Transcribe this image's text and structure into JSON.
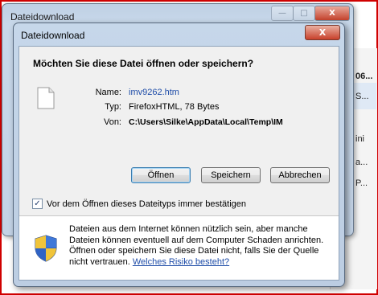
{
  "background_window": {
    "title": "Dateidownload",
    "minimize_label": "—",
    "maximize_label": "□",
    "close_label": "X",
    "rows": [
      "06...",
      "S...",
      "ini",
      "a...",
      "P..."
    ]
  },
  "dialog": {
    "title": "Dateidownload",
    "close_label": "X",
    "question": "Möchten Sie diese Datei öffnen oder speichern?",
    "fields": [
      {
        "label": "Name:",
        "value": "imv9262.htm"
      },
      {
        "label": "Typ:",
        "value": "FirefoxHTML, 78 Bytes"
      },
      {
        "label": "Von:",
        "value": "C:\\Users\\Silke\\AppData\\Local\\Temp\\IM"
      }
    ],
    "buttons": {
      "open": "Öffnen",
      "save": "Speichern",
      "cancel": "Abbrechen"
    },
    "checkbox": {
      "label": "Vor dem Öffnen dieses Dateityps immer bestätigen",
      "checked": true
    },
    "info": {
      "text": "Dateien aus dem Internet können nützlich sein, aber manche Dateien können eventuell auf dem Computer Schaden anrichten. Öffnen oder speichern Sie diese Datei nicht, falls Sie der Quelle nicht vertrauen. ",
      "link": "Welches Risiko besteht?"
    }
  },
  "colors": {
    "frame_border": "#d00000",
    "window_chrome": "#c6d7ea",
    "link": "#1f4da8"
  }
}
